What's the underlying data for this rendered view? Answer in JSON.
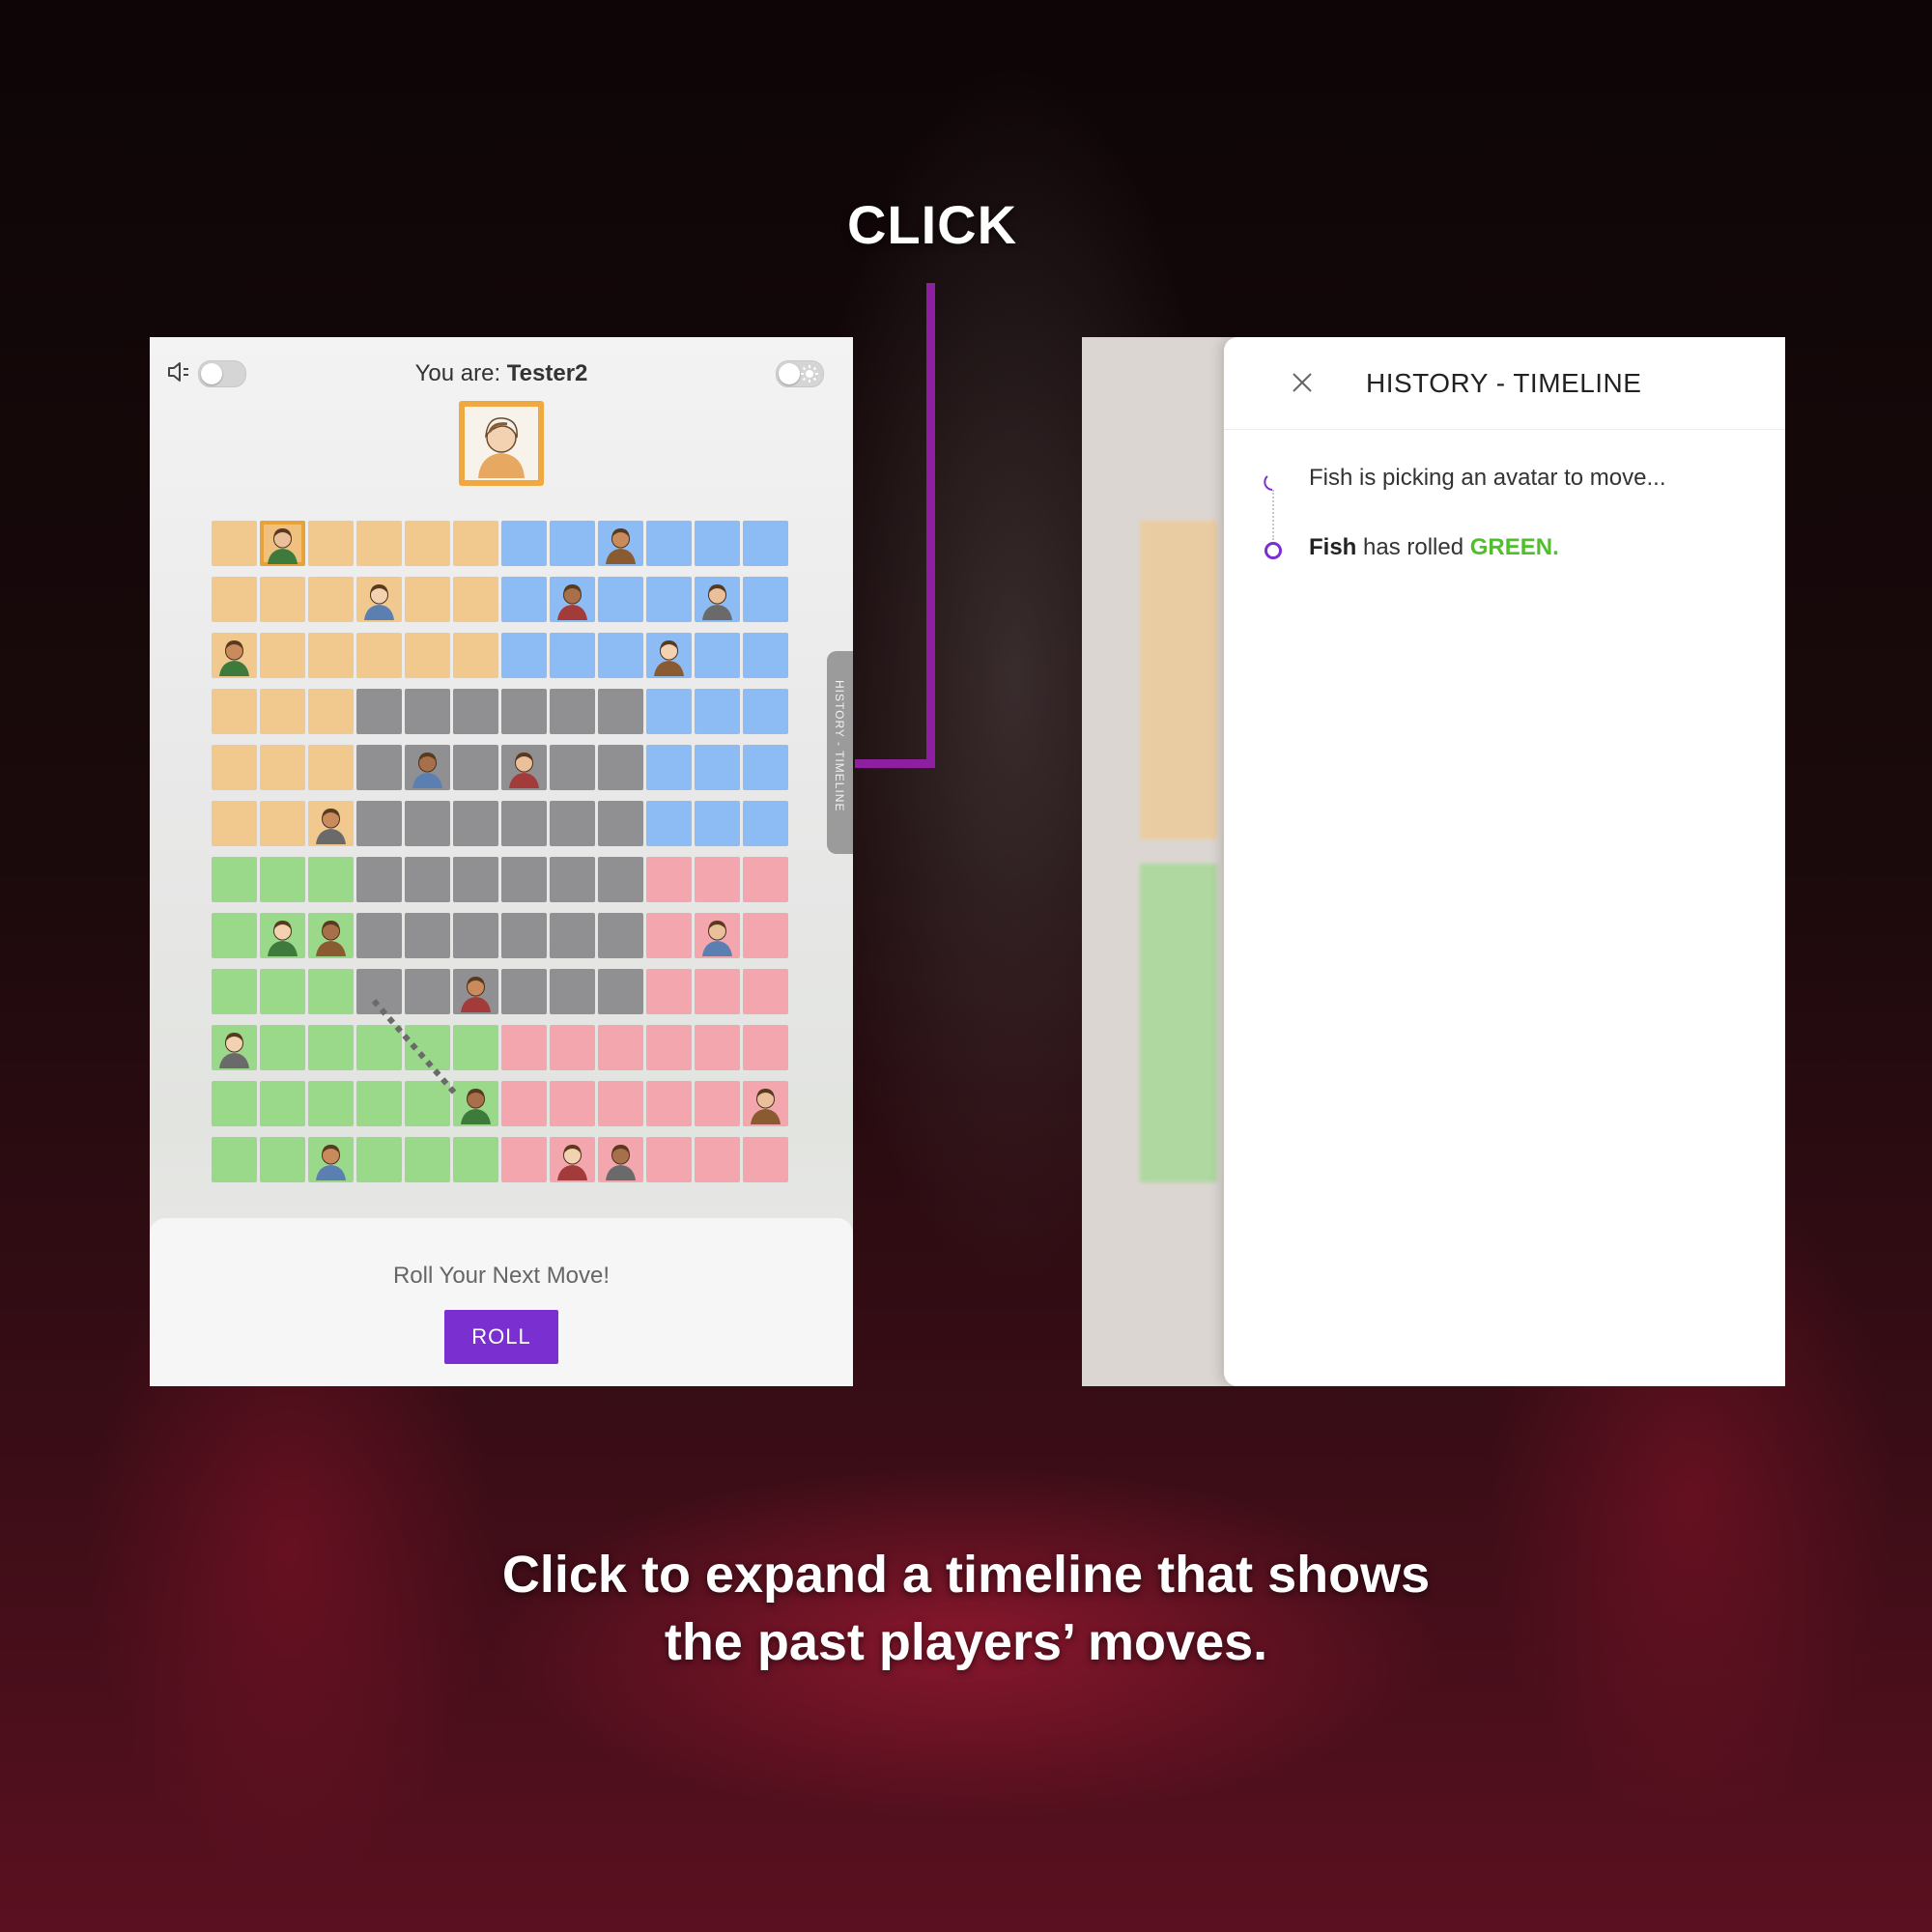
{
  "colors": {
    "accent_purple": "#7a2fd0",
    "connector": "#8e1fa0",
    "orange": "#f1c98f",
    "blue": "#8cbcf3",
    "gray": "#909092",
    "green": "#9bd98a",
    "pink": "#f3a6ad",
    "rolled_green_text": "#4fbf2c"
  },
  "annotation": {
    "click_label": "CLICK",
    "caption_line1": "Click to expand a timeline that shows",
    "caption_line2": "the past players’ moves."
  },
  "game": {
    "you_are_label": "You are:",
    "player_name": "Tester2",
    "sound_icon": "speaker-icon",
    "theme_icon": "sun-icon",
    "history_tab_label": "HISTORY - TIMELINE",
    "roll_prompt": "Roll Your Next Move!",
    "roll_button": "ROLL",
    "board": {
      "rows": [
        [
          "o",
          "o",
          "o",
          "o",
          "o",
          "o",
          "b",
          "b",
          "b",
          "b",
          "b",
          "b"
        ],
        [
          "o",
          "o",
          "o",
          "o",
          "o",
          "o",
          "b",
          "b",
          "b",
          "b",
          "b",
          "b"
        ],
        [
          "o",
          "o",
          "o",
          "o",
          "o",
          "o",
          "b",
          "b",
          "b",
          "b",
          "b",
          "b"
        ],
        [
          "o",
          "o",
          "o",
          "g",
          "g",
          "g",
          "g",
          "g",
          "g",
          "b",
          "b",
          "b"
        ],
        [
          "o",
          "o",
          "o",
          "g",
          "g",
          "g",
          "g",
          "g",
          "g",
          "b",
          "b",
          "b"
        ],
        [
          "o",
          "o",
          "o",
          "g",
          "g",
          "g",
          "g",
          "g",
          "g",
          "b",
          "b",
          "b"
        ],
        [
          "gr",
          "gr",
          "gr",
          "g",
          "g",
          "g",
          "g",
          "g",
          "g",
          "r",
          "r",
          "r"
        ],
        [
          "gr",
          "gr",
          "gr",
          "g",
          "g",
          "g",
          "g",
          "g",
          "g",
          "r",
          "r",
          "r"
        ],
        [
          "gr",
          "gr",
          "gr",
          "g",
          "g",
          "g",
          "g",
          "g",
          "g",
          "r",
          "r",
          "r"
        ],
        [
          "gr",
          "gr",
          "gr",
          "gr",
          "gr",
          "gr",
          "r",
          "r",
          "r",
          "r",
          "r",
          "r"
        ],
        [
          "gr",
          "gr",
          "gr",
          "gr",
          "gr",
          "gr",
          "r",
          "r",
          "r",
          "r",
          "r",
          "r"
        ],
        [
          "gr",
          "gr",
          "gr",
          "gr",
          "gr",
          "gr",
          "r",
          "r",
          "r",
          "r",
          "r",
          "r"
        ]
      ],
      "avatars": [
        {
          "row": 0,
          "col": 1,
          "own": true
        },
        {
          "row": 0,
          "col": 8
        },
        {
          "row": 1,
          "col": 3
        },
        {
          "row": 1,
          "col": 7
        },
        {
          "row": 1,
          "col": 10
        },
        {
          "row": 2,
          "col": 0
        },
        {
          "row": 2,
          "col": 9
        },
        {
          "row": 4,
          "col": 4
        },
        {
          "row": 4,
          "col": 6
        },
        {
          "row": 5,
          "col": 2
        },
        {
          "row": 7,
          "col": 1
        },
        {
          "row": 7,
          "col": 2
        },
        {
          "row": 7,
          "col": 10
        },
        {
          "row": 8,
          "col": 5
        },
        {
          "row": 9,
          "col": 0
        },
        {
          "row": 10,
          "col": 5
        },
        {
          "row": 10,
          "col": 11
        },
        {
          "row": 11,
          "col": 2
        },
        {
          "row": 11,
          "col": 7
        },
        {
          "row": 11,
          "col": 8
        }
      ]
    }
  },
  "history": {
    "title": "HISTORY - TIMELINE",
    "close_icon": "close-icon",
    "entry1": "Fish is picking an avatar to move...",
    "entry2_player": "Fish",
    "entry2_text": " has rolled ",
    "entry2_color": "GREEN."
  }
}
